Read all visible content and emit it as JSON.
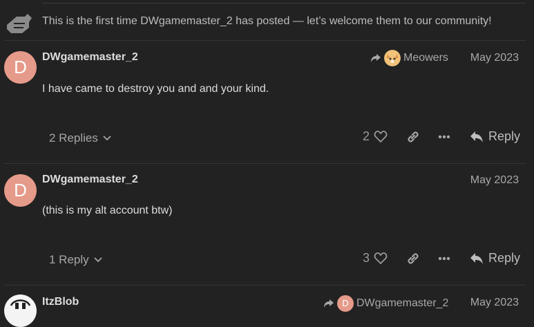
{
  "notice": {
    "text": "This is the first time DWgamemaster_2 has posted — let’s welcome them to our community!",
    "icon": "hand-wave-icon"
  },
  "posts": [
    {
      "avatar_letter": "D",
      "username": "DWgamemaster_2",
      "reply_to": "Meowers",
      "date": "May 2023",
      "body": "I have came to destroy you and and your kind.",
      "replies_label": "2 Replies",
      "likes": "2",
      "reply_label": "Reply"
    },
    {
      "avatar_letter": "D",
      "username": "DWgamemaster_2",
      "date": "May 2023",
      "body": "(this is my alt account btw)",
      "replies_label": "1 Reply",
      "likes": "3",
      "reply_label": "Reply"
    },
    {
      "username": "ItzBlob",
      "reply_to": "DWgamemaster_2",
      "reply_to_letter": "D",
      "date": "May 2023"
    }
  ],
  "colors": {
    "background": "#222222",
    "avatar_d": "#e69a8a",
    "muted": "#a8a8a8"
  }
}
